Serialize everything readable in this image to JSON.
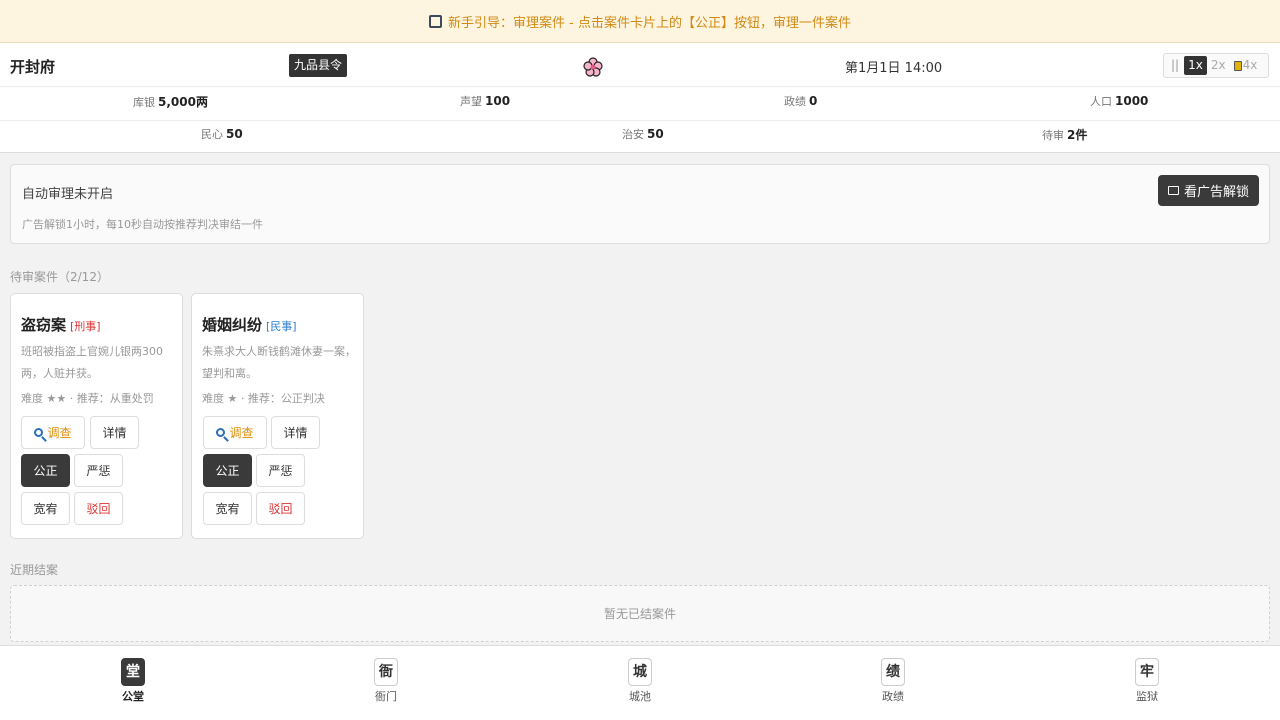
{
  "banner": {
    "text": "新手引导：审理案件 - 点击案件卡片上的【公正】按钮，审理一件案件"
  },
  "header": {
    "city": "开封府",
    "rank": "九品县令",
    "date": "第1月1日 14:00",
    "speed": {
      "pause": "||",
      "x1": "1x",
      "x2": "2x",
      "x4": "4x"
    }
  },
  "stats": {
    "treasury": {
      "label": "库银",
      "value": "5,000两"
    },
    "reputation": {
      "label": "声望",
      "value": "100"
    },
    "merit": {
      "label": "政绩",
      "value": "0"
    },
    "population": {
      "label": "人口",
      "value": "1000"
    },
    "morale": {
      "label": "民心",
      "value": "50"
    },
    "security": {
      "label": "治安",
      "value": "50"
    },
    "pending": {
      "label": "待审",
      "value": "2件"
    }
  },
  "auto": {
    "title": "自动审理未开启",
    "desc": "广告解锁1小时，每10秒自动按推荐判决审结一件",
    "button": "看广告解锁"
  },
  "pending_label": "待审案件（2/12）",
  "cases": [
    {
      "title": "盗窃案",
      "tag": "[刑事]",
      "desc": "班昭被指盗上官婉儿银两300两，人赃并获。",
      "meta": "难度 ★★ · 推荐：从重处罚",
      "buttons": {
        "investigate": "调查",
        "details": "详情",
        "fair": "公正",
        "strict": "严惩",
        "lenient": "宽宥",
        "dismiss": "驳回"
      }
    },
    {
      "title": "婚姻纠纷",
      "tag": "[民事]",
      "desc": "朱熹求大人断钱鹤滩休妻一案，望判和离。",
      "meta": "难度 ★ · 推荐：公正判决",
      "buttons": {
        "investigate": "调查",
        "details": "详情",
        "fair": "公正",
        "strict": "严惩",
        "lenient": "宽宥",
        "dismiss": "驳回"
      }
    }
  ],
  "recent_label": "近期结案",
  "recent_empty": "暂无已结案件",
  "nav": [
    {
      "icon": "堂",
      "label": "公堂"
    },
    {
      "icon": "衙",
      "label": "衙门"
    },
    {
      "icon": "城",
      "label": "城池"
    },
    {
      "icon": "绩",
      "label": "政绩"
    },
    {
      "icon": "牢",
      "label": "监狱"
    }
  ],
  "colors": {
    "accent_orange": "#d28a15",
    "dark_button": "#3a3a3a",
    "criminal_red": "#dd3333",
    "civil_blue": "#2a7ed3"
  }
}
